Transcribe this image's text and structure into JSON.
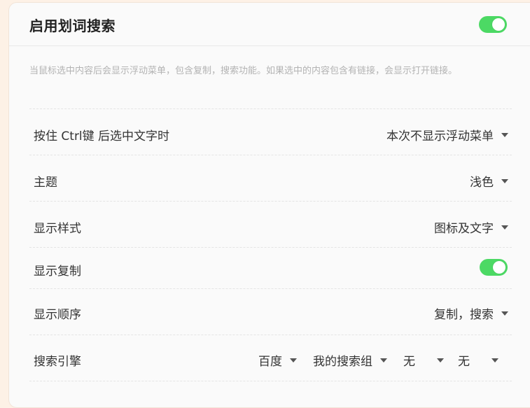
{
  "header": {
    "title": "启用划词搜索",
    "enabled": true
  },
  "description": "当鼠标选中内容后会显示浮动菜单，包含复制，搜索功能。如果选中的内容包含有链接，会显示打开链接。",
  "rows": {
    "ctrl_key": {
      "label": "按住 Ctrl键 后选中文字时",
      "value": "本次不显示浮动菜单"
    },
    "theme": {
      "label": "主题",
      "value": "浅色"
    },
    "display_style": {
      "label": "显示样式",
      "value": "图标及文字"
    },
    "show_copy": {
      "label": "显示复制",
      "enabled": true
    },
    "display_order": {
      "label": "显示顺序",
      "value": "复制，搜索"
    },
    "search_engine": {
      "label": "搜索引擎",
      "selects": [
        "百度",
        "我的搜索组",
        "无",
        "无"
      ]
    }
  },
  "colors": {
    "toggle_on": "#4cd964",
    "background": "#fdf1e6",
    "card": "#fafafa"
  }
}
